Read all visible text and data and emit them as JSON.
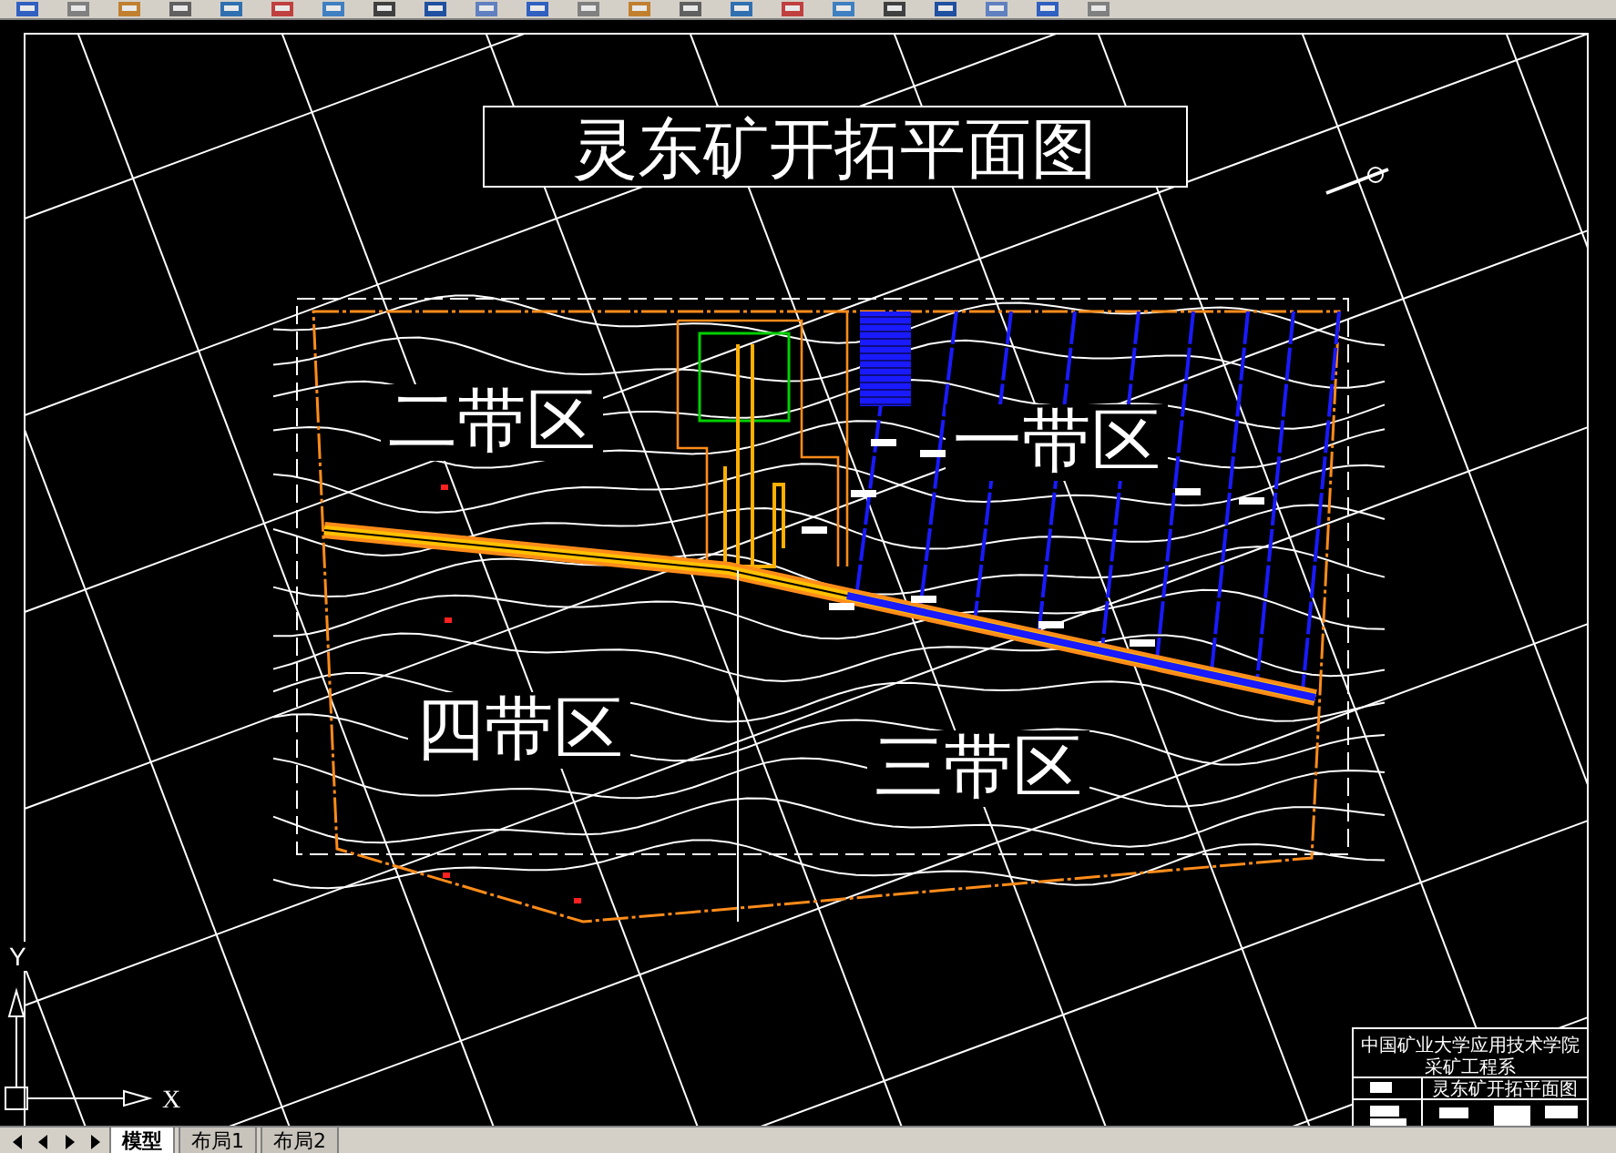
{
  "drawing": {
    "title": "灵东矿开拓平面图",
    "zones": [
      {
        "label": "二带区"
      },
      {
        "label": "一带区"
      },
      {
        "label": "四带区"
      },
      {
        "label": "三带区"
      }
    ],
    "title_block": {
      "institution": "中国矿业大学应用技术学院",
      "department": "采矿工程系",
      "drawing_name": "灵东矿开拓平面图"
    },
    "ucs": {
      "x_label": "X",
      "y_label": "Y"
    }
  },
  "layout_tabs": [
    {
      "label": "模型",
      "selected": true
    },
    {
      "label": "布局1",
      "selected": false
    },
    {
      "label": "布局2",
      "selected": false
    }
  ]
}
